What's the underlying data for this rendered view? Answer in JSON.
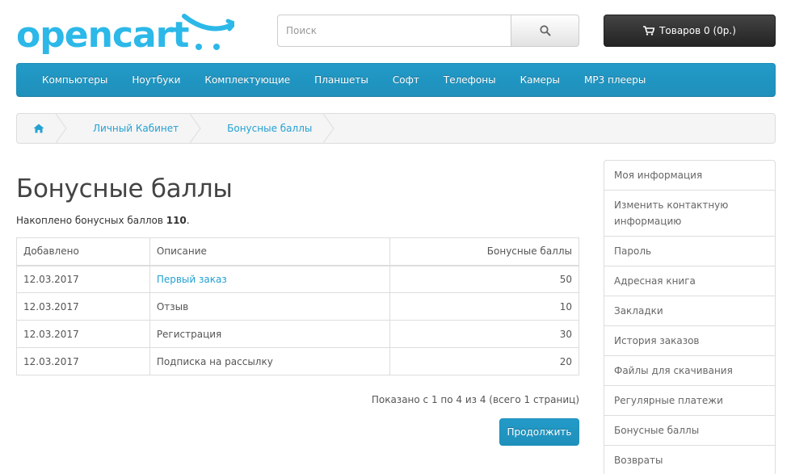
{
  "logo": {
    "text": "opencart"
  },
  "search": {
    "placeholder": "Поиск"
  },
  "cart": {
    "label": "Товаров 0 (0р.)"
  },
  "menu": {
    "items": [
      "Компьютеры",
      "Ноутбуки",
      "Комплектующие",
      "Планшеты",
      "Софт",
      "Телефоны",
      "Камеры",
      "MP3 плееры"
    ]
  },
  "breadcrumb": {
    "items": [
      "Личный Кабинет",
      "Бонусные баллы"
    ]
  },
  "page": {
    "title": "Бонусные баллы",
    "summary_prefix": "Накоплено бонусных баллов ",
    "summary_value": "110",
    "summary_suffix": "."
  },
  "table": {
    "headers": [
      "Добавлено",
      "Описание",
      "Бонусные баллы"
    ],
    "rows": [
      {
        "date": "12.03.2017",
        "description": "Первый заказ",
        "points": "50"
      },
      {
        "date": "12.03.2017",
        "description": "Отзыв",
        "points": "10"
      },
      {
        "date": "12.03.2017",
        "description": "Регистрация",
        "points": "30"
      },
      {
        "date": "12.03.2017",
        "description": "Подписка на рассылку",
        "points": "20"
      }
    ]
  },
  "pager": {
    "text": "Показано с 1 по 4 из 4 (всего 1 страниц)"
  },
  "continue_label": "Продолжить",
  "sidebar": {
    "items": [
      "Моя информация",
      "Изменить контактную информацию",
      "Пароль",
      "Адресная книга",
      "Закладки",
      "История заказов",
      "Файлы для скачивания",
      "Регулярные платежи",
      "Бонусные баллы",
      "Возвраты"
    ]
  },
  "colors": {
    "brand_blue": "#229ac8",
    "link": "#23a1d1",
    "cart_bg": "#363636"
  },
  "icons": {
    "search": "search-icon",
    "cart": "cart-icon",
    "home": "home-icon"
  }
}
